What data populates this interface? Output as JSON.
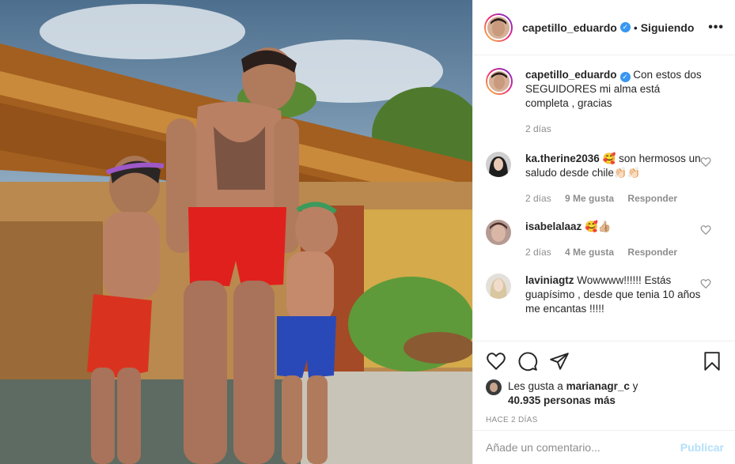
{
  "post": {
    "author": "capetillo_eduardo",
    "verified": true,
    "separator": "•",
    "follow_status": "Siguiendo",
    "more_label": "•••",
    "photo_alt_icon": "post-photo"
  },
  "caption": {
    "username": "capetillo_eduardo",
    "text": "Con estos dos SEGUIDORES mi alma está completa , gracias",
    "time": "2 días"
  },
  "comments": [
    {
      "username": "ka.therine2036",
      "text": "🥰 son hermosos un saludo desde chile👏🏻👏🏻",
      "time": "2 días",
      "likes": "9 Me gusta",
      "reply": "Responder"
    },
    {
      "username": "isabelalaaz",
      "text": "🥰👍🏼",
      "time": "2 días",
      "likes": "4 Me gusta",
      "reply": "Responder"
    },
    {
      "username": "laviniagtz",
      "text": "Wowwww!!!!!! Estás guapísimo , desde que tenia 10 años me encantas !!!!!",
      "time": "",
      "likes": "",
      "reply": ""
    }
  ],
  "likes": {
    "prefix": "Les gusta a",
    "user": "marianagr_c",
    "conj": "y",
    "count": "40.935 personas más"
  },
  "posted_ago": "HACE 2 DÍAS",
  "add_comment": {
    "placeholder": "Añade un comentario...",
    "publish": "Publicar"
  },
  "colors": {
    "verified": "#3897f0",
    "publish_disabled": "#b2dffc",
    "meta_gray": "#8e8e8e"
  }
}
